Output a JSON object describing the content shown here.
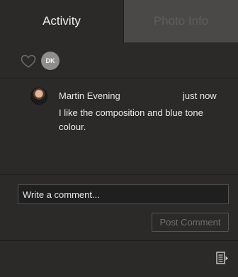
{
  "tabs": [
    {
      "label": "Activity",
      "active": true
    },
    {
      "label": "Photo Info",
      "active": false
    }
  ],
  "likes": {
    "heart_icon": "heart-outline-icon",
    "badge_initials": "DK"
  },
  "comments": [
    {
      "author": "Martin Evening",
      "time": "just now",
      "text": "I like the composition and blue tone colour."
    }
  ],
  "composer": {
    "placeholder": "Write a comment...",
    "value": "",
    "post_label": "Post Comment"
  },
  "footer": {
    "icon": "panel-menu-icon"
  },
  "colors": {
    "panel_bg": "#2b2a29",
    "inactive_tab_bg": "#4a4948",
    "badge_bg": "#8e8e8e"
  }
}
